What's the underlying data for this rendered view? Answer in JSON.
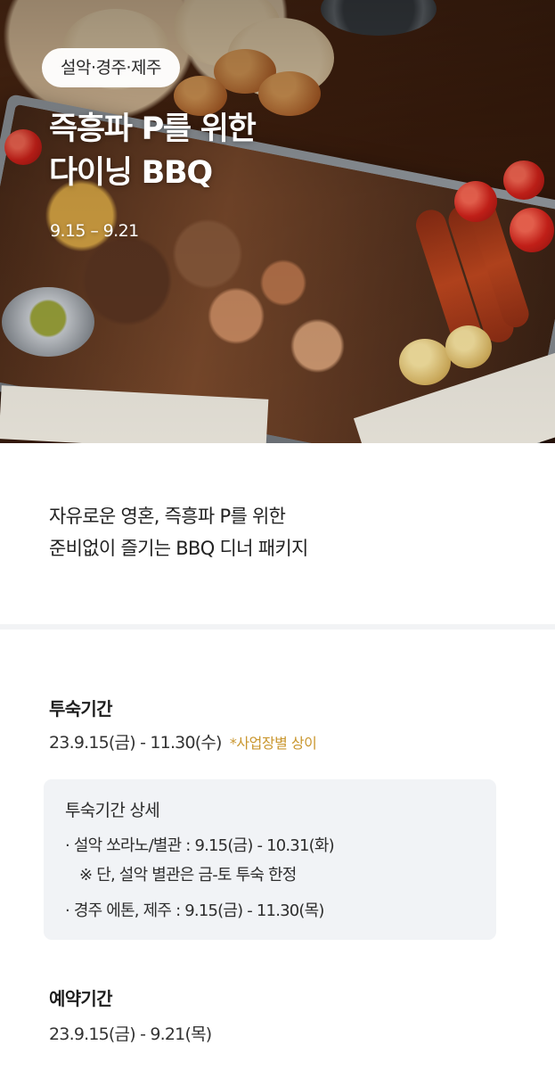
{
  "banner": {
    "location_tag": "설악·경주·제주",
    "title_line1": "즉흥파 P를 위한",
    "title_line2": "다이닝 BBQ",
    "date_range": "9.15 – 9.21"
  },
  "intro": {
    "line1": "자유로운 영혼, 즉흥파 P를 위한",
    "line2": "준비없이 즐기는 BBQ 디너 패키지"
  },
  "stay_period": {
    "label": "투숙기간",
    "value": "23.9.15(금) - 11.30(수)",
    "note": "*사업장별 상이"
  },
  "stay_details": {
    "title": "투숙기간 상세",
    "items": [
      "· 설악 쏘라노/별관 : 9.15(금) - 10.31(화)",
      "※ 단, 설악 별관은 금-토 투숙 한정",
      "· 경주 에톤, 제주 : 9.15(금) - 11.30(목)"
    ]
  },
  "booking_period": {
    "label": "예약기간",
    "value": "23.9.15(금) - 9.21(목)"
  },
  "colors": {
    "note_accent": "#c9962e",
    "detail_box_bg": "#f1f3f6",
    "divider": "#f2f3f5"
  }
}
